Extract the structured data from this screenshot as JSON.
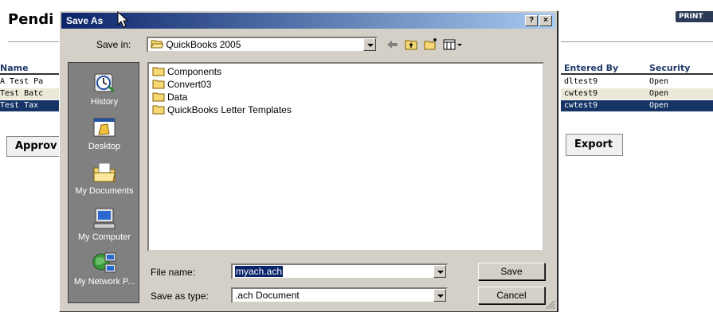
{
  "page": {
    "title": "Pendi",
    "print_label": "PRINT",
    "columns": {
      "name": "Name",
      "entered_by": "Entered By",
      "security": "Security"
    },
    "rows": [
      {
        "name": "A Test Pa",
        "entered_by": "dltest9",
        "security": "Open",
        "state": "normal"
      },
      {
        "name": "Test Batc",
        "entered_by": "cwtest9",
        "security": "Open",
        "state": "alt"
      },
      {
        "name": "Test Tax",
        "entered_by": "cwtest9",
        "security": "Open",
        "state": "selected"
      }
    ],
    "approve_label": "Approv",
    "export_label": "Export"
  },
  "dialog": {
    "title": "Save As",
    "help_btn": "?",
    "close_btn": "×",
    "save_in_label": "Save in:",
    "save_in_value": "QuickBooks 2005",
    "places": [
      {
        "label": "History",
        "icon": "history-icon"
      },
      {
        "label": "Desktop",
        "icon": "desktop-icon"
      },
      {
        "label": "My Documents",
        "icon": "my-documents-icon"
      },
      {
        "label": "My Computer",
        "icon": "my-computer-icon"
      },
      {
        "label": "My Network P...",
        "icon": "my-network-icon"
      }
    ],
    "files": [
      "Components",
      "Convert03",
      "Data",
      "QuickBooks Letter Templates"
    ],
    "file_name_label": "File name:",
    "file_name_value": "myach.ach",
    "save_type_label": "Save as type:",
    "save_type_value": ".ach Document",
    "save_button": "Save",
    "cancel_button": "Cancel"
  },
  "colors": {
    "title_start": "#0a246a",
    "title_end": "#a6caf0",
    "selection": "#163466",
    "dialog_face": "#d4d0c8"
  }
}
